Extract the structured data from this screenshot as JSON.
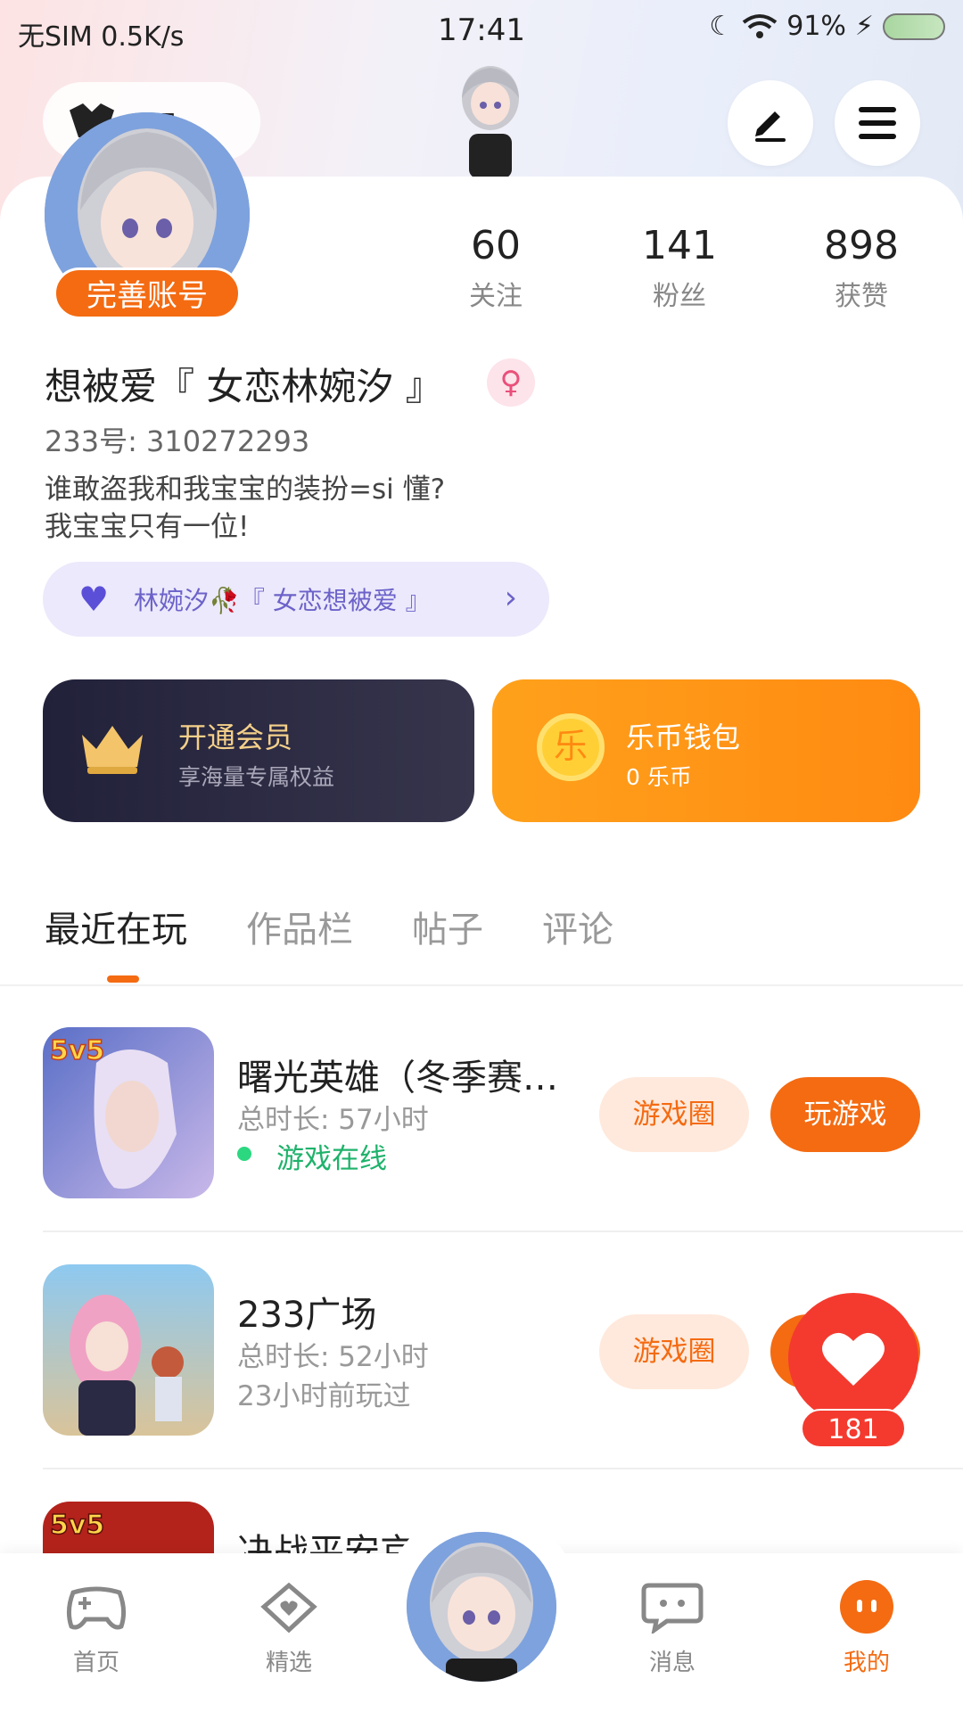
{
  "status_bar": {
    "carrier": "无SIM 0.5K/s",
    "time": "17:41",
    "battery": "91%"
  },
  "header": {
    "pill_text": "眼"
  },
  "profile": {
    "complete_badge": "完善账号",
    "stats": [
      {
        "value": "60",
        "label": "关注"
      },
      {
        "value": "141",
        "label": "粉丝"
      },
      {
        "value": "898",
        "label": "获赞"
      }
    ],
    "nickname": "想被爱『 女恋林婉汐 』",
    "uid": "233号: 310272293",
    "bio_line1": "谁敢盗我和我宝宝的装扮=si  懂?",
    "bio_line2": "我宝宝只有一位!",
    "couple_text": "林婉汐🥀『 女恋想被爱 』"
  },
  "cards": {
    "vip_title": "开通会员",
    "vip_sub": "享海量专属权益",
    "wallet_title": "乐币钱包",
    "wallet_sub": "0 乐币",
    "coin_glyph": "乐"
  },
  "tabs": [
    "最近在玩",
    "作品栏",
    "帖子",
    "评论"
  ],
  "games": [
    {
      "name": "曙光英雄（冬季赛…",
      "meta": "总时长: 57小时",
      "status": "游戏在线",
      "online": true,
      "circle_label": "游戏圈",
      "play_label": "玩游戏"
    },
    {
      "name": "233广场",
      "meta": "总时长: 52小时",
      "status": "23小时前玩过",
      "online": false,
      "circle_label": "游戏圈",
      "play_label": "玩游戏"
    },
    {
      "name": "决战平安京"
    }
  ],
  "fab": {
    "count": "181"
  },
  "bottom_nav": [
    {
      "label": "首页"
    },
    {
      "label": "精选"
    },
    {
      "label": "消息"
    },
    {
      "label": "我的"
    }
  ],
  "colors": {
    "accent": "#f46b12",
    "online": "#1fb26b",
    "fab": "#f43a2e"
  }
}
